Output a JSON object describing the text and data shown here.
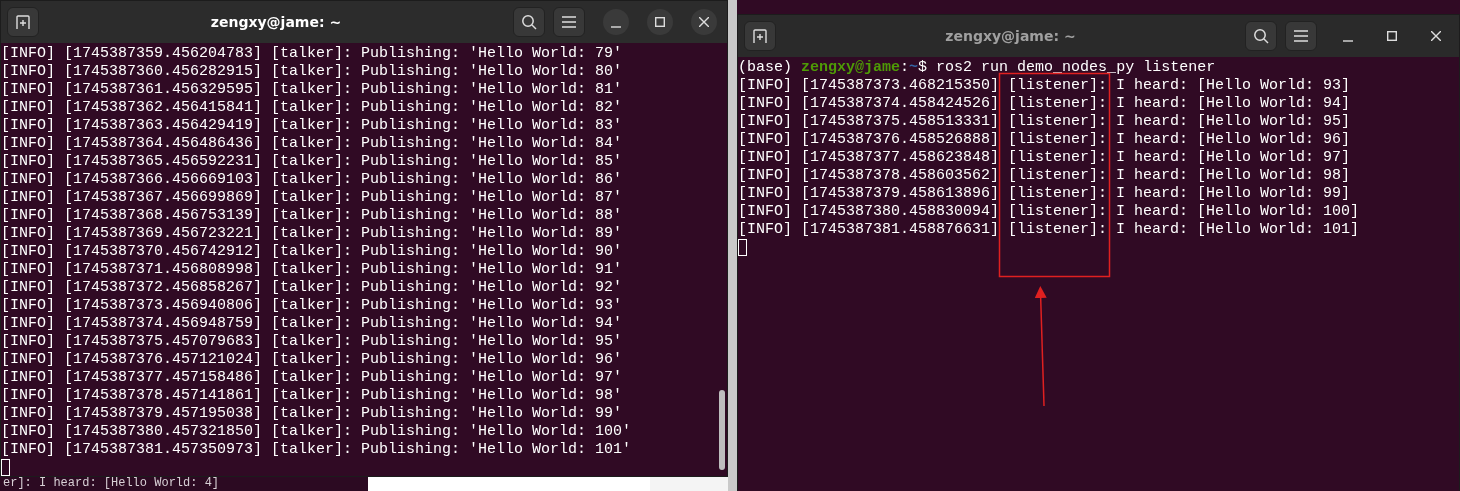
{
  "windows": [
    {
      "title": "zengxy@jame: ~",
      "focused": true,
      "cursor": true,
      "scrollbar": true,
      "lines": [
        {
          "kind": "output",
          "text": "[INFO] [1745387359.456204783] [talker]: Publishing: 'Hello World: 79'"
        },
        {
          "kind": "output",
          "text": "[INFO] [1745387360.456282915] [talker]: Publishing: 'Hello World: 80'"
        },
        {
          "kind": "output",
          "text": "[INFO] [1745387361.456329595] [talker]: Publishing: 'Hello World: 81'"
        },
        {
          "kind": "output",
          "text": "[INFO] [1745387362.456415841] [talker]: Publishing: 'Hello World: 82'"
        },
        {
          "kind": "output",
          "text": "[INFO] [1745387363.456429419] [talker]: Publishing: 'Hello World: 83'"
        },
        {
          "kind": "output",
          "text": "[INFO] [1745387364.456486436] [talker]: Publishing: 'Hello World: 84'"
        },
        {
          "kind": "output",
          "text": "[INFO] [1745387365.456592231] [talker]: Publishing: 'Hello World: 85'"
        },
        {
          "kind": "output",
          "text": "[INFO] [1745387366.456669103] [talker]: Publishing: 'Hello World: 86'"
        },
        {
          "kind": "output",
          "text": "[INFO] [1745387367.456699869] [talker]: Publishing: 'Hello World: 87'"
        },
        {
          "kind": "output",
          "text": "[INFO] [1745387368.456753139] [talker]: Publishing: 'Hello World: 88'"
        },
        {
          "kind": "output",
          "text": "[INFO] [1745387369.456723221] [talker]: Publishing: 'Hello World: 89'"
        },
        {
          "kind": "output",
          "text": "[INFO] [1745387370.456742912] [talker]: Publishing: 'Hello World: 90'"
        },
        {
          "kind": "output",
          "text": "[INFO] [1745387371.456808998] [talker]: Publishing: 'Hello World: 91'"
        },
        {
          "kind": "output",
          "text": "[INFO] [1745387372.456858267] [talker]: Publishing: 'Hello World: 92'"
        },
        {
          "kind": "output",
          "text": "[INFO] [1745387373.456940806] [talker]: Publishing: 'Hello World: 93'"
        },
        {
          "kind": "output",
          "text": "[INFO] [1745387374.456948759] [talker]: Publishing: 'Hello World: 94'"
        },
        {
          "kind": "output",
          "text": "[INFO] [1745387375.457079683] [talker]: Publishing: 'Hello World: 95'"
        },
        {
          "kind": "output",
          "text": "[INFO] [1745387376.457121024] [talker]: Publishing: 'Hello World: 96'"
        },
        {
          "kind": "output",
          "text": "[INFO] [1745387377.457158486] [talker]: Publishing: 'Hello World: 97'"
        },
        {
          "kind": "output",
          "text": "[INFO] [1745387378.457141861] [talker]: Publishing: 'Hello World: 98'"
        },
        {
          "kind": "output",
          "text": "[INFO] [1745387379.457195038] [talker]: Publishing: 'Hello World: 99'"
        },
        {
          "kind": "output",
          "text": "[INFO] [1745387380.457321850] [talker]: Publishing: 'Hello World: 100'"
        },
        {
          "kind": "output",
          "text": "[INFO] [1745387381.457350973] [talker]: Publishing: 'Hello World: 101'"
        }
      ]
    },
    {
      "title": "zengxy@jame: ~",
      "focused": false,
      "cursor": true,
      "lines": [
        {
          "kind": "prompt",
          "env": "(base)",
          "user_host": "zengxy@jame",
          "separator": ":",
          "path": "~",
          "command": "$ ros2 run demo_nodes_py listener"
        },
        {
          "kind": "output",
          "text": "[INFO] [1745387373.468215350] [listener]: I heard: [Hello World: 93]"
        },
        {
          "kind": "output",
          "text": "[INFO] [1745387374.458424526] [listener]: I heard: [Hello World: 94]"
        },
        {
          "kind": "output",
          "text": "[INFO] [1745387375.458513331] [listener]: I heard: [Hello World: 95]"
        },
        {
          "kind": "output",
          "text": "[INFO] [1745387376.458526888] [listener]: I heard: [Hello World: 96]"
        },
        {
          "kind": "output",
          "text": "[INFO] [1745387377.458623848] [listener]: I heard: [Hello World: 97]"
        },
        {
          "kind": "output",
          "text": "[INFO] [1745387378.458603562] [listener]: I heard: [Hello World: 98]"
        },
        {
          "kind": "output",
          "text": "[INFO] [1745387379.458613896] [listener]: I heard: [Hello World: 99]"
        },
        {
          "kind": "output",
          "text": "[INFO] [1745387380.458830094] [listener]: I heard: [Hello World: 100]"
        },
        {
          "kind": "output",
          "text": "[INFO] [1745387381.458876631] [listener]: I heard: [Hello World: 101]"
        }
      ]
    }
  ],
  "background_terminal": {
    "text": "er]: I heard: [Hello World: 4]"
  }
}
